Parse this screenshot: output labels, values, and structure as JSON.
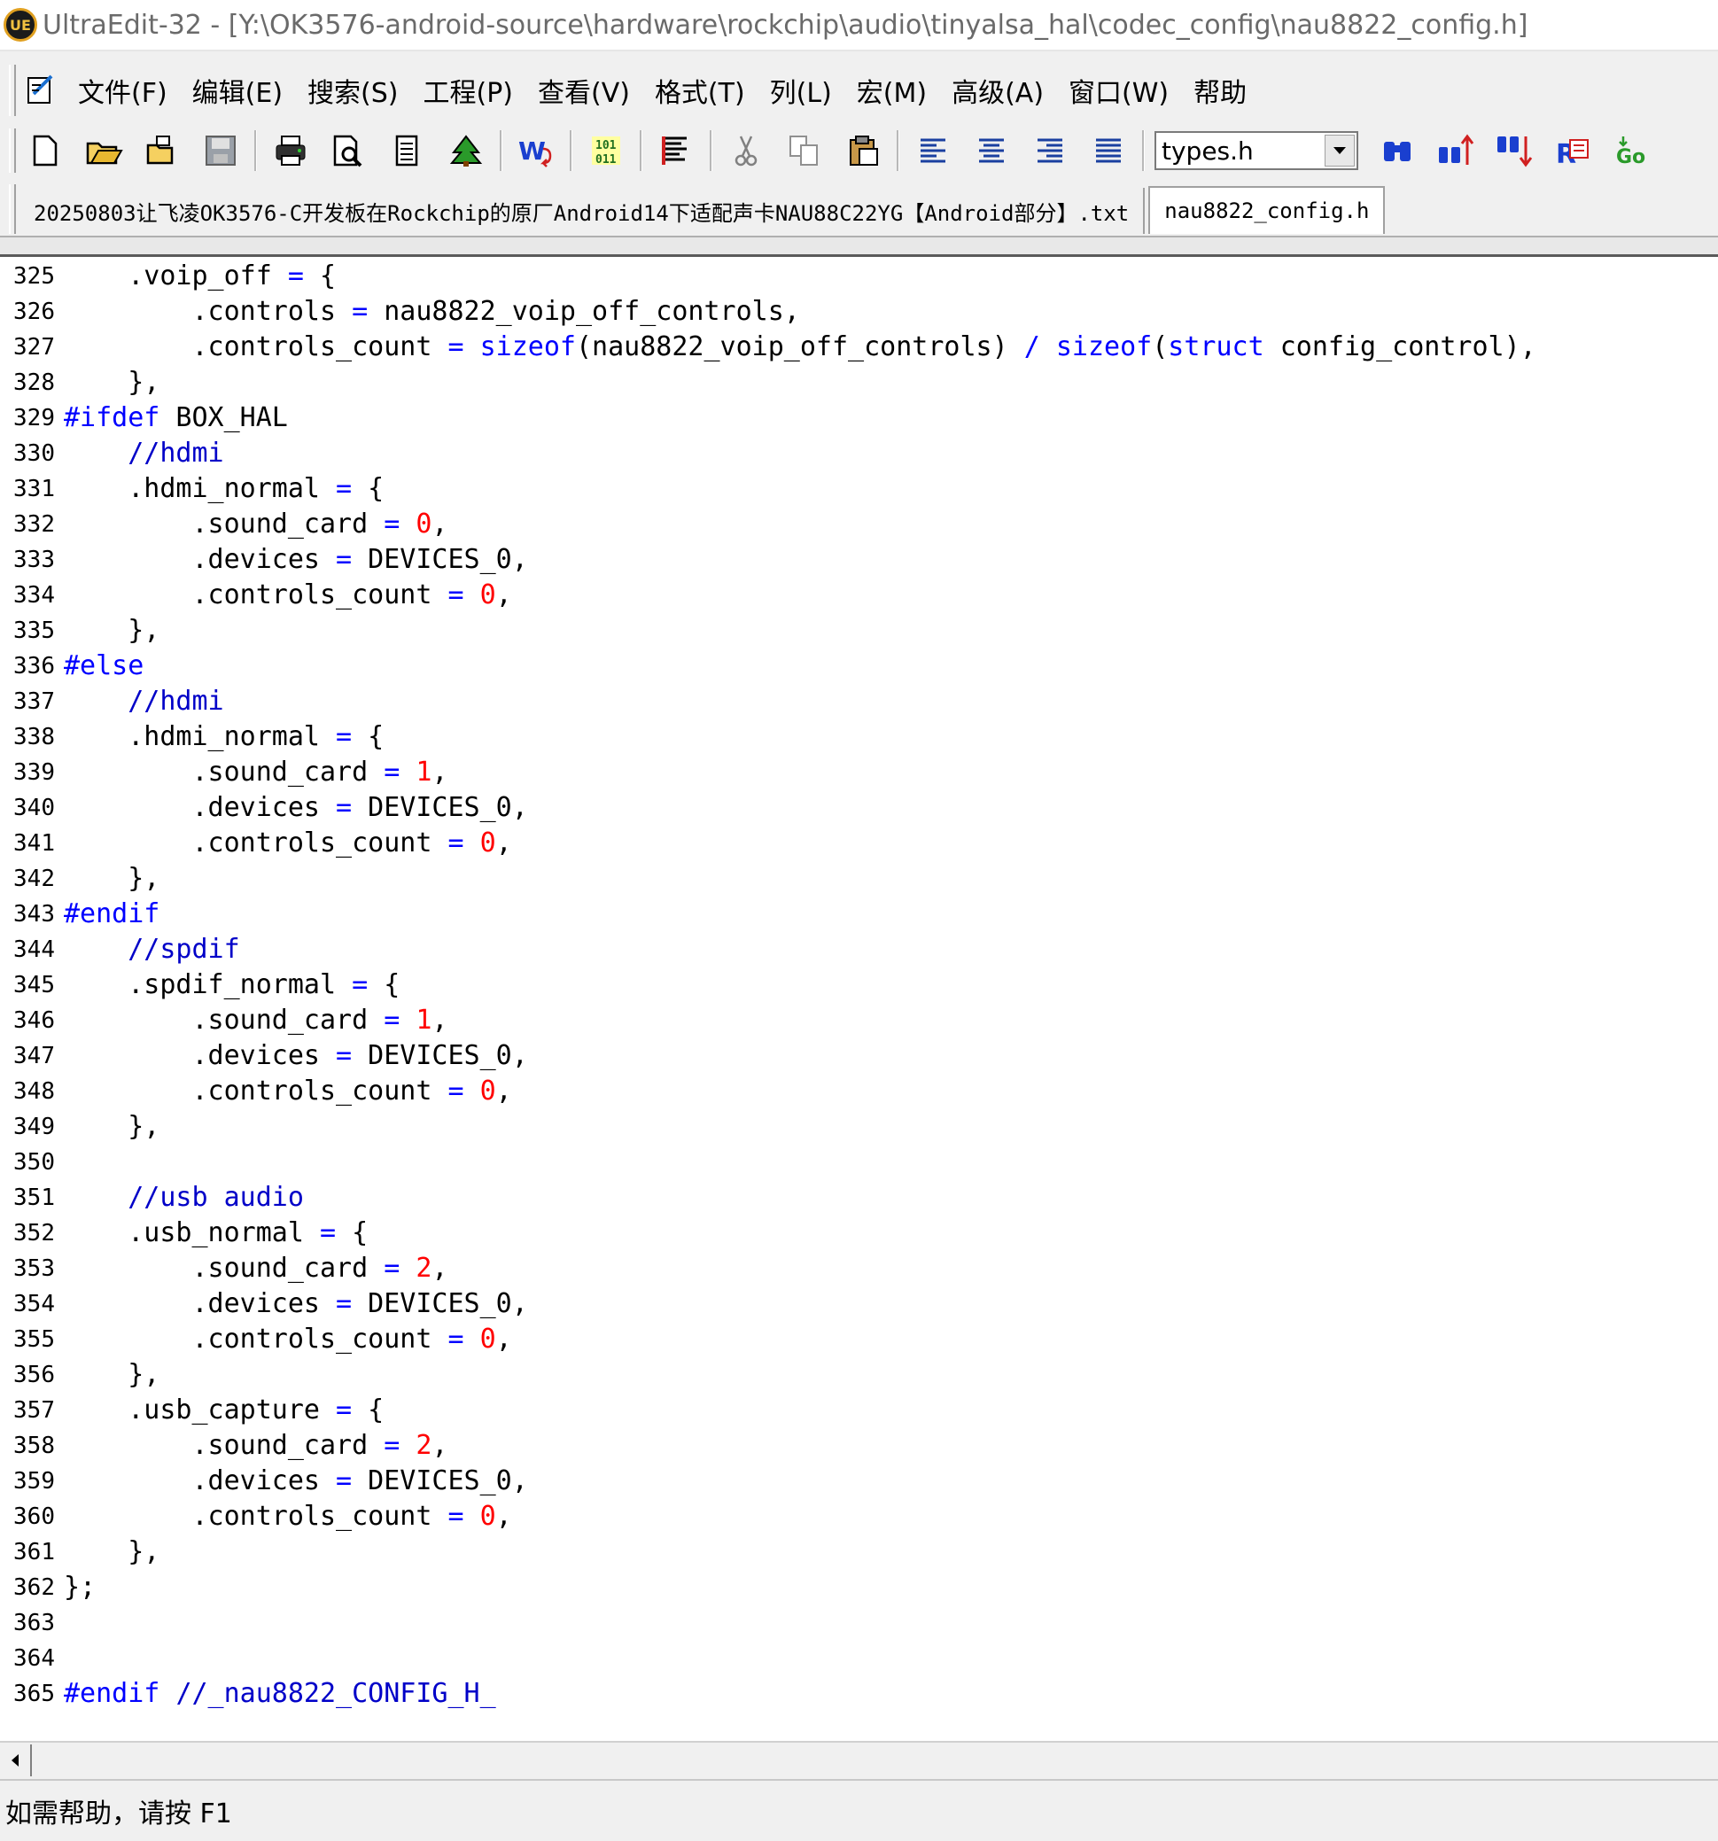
{
  "window": {
    "title": "UltraEdit-32 - [Y:\\OK3576-android-source\\hardware\\rockchip\\audio\\tinyalsa_hal\\codec_config\\nau8822_config.h]",
    "logo_text": "UE"
  },
  "menu": {
    "items": [
      "文件(F)",
      "编辑(E)",
      "搜索(S)",
      "工程(P)",
      "查看(V)",
      "格式(T)",
      "列(L)",
      "宏(M)",
      "高级(A)",
      "窗口(W)",
      "帮助"
    ]
  },
  "toolbar": {
    "buttons": [
      "new-file-icon",
      "open-file-icon",
      "open-recent-icon",
      "save-icon",
      "print-icon",
      "print-preview-icon",
      "column-markers-icon",
      "tree-icon",
      "word-wrap-icon",
      "hex-mode-icon",
      "spell-check-icon",
      "cut-icon",
      "copy-icon",
      "paste-icon",
      "align-left-icon",
      "align-center-icon",
      "align-right-icon",
      "justify-icon"
    ],
    "function_combo_value": "types.h",
    "search_buttons": [
      "find-icon",
      "find-previous-icon",
      "find-next-icon",
      "replace-icon",
      "goto-icon"
    ]
  },
  "tabs": [
    {
      "label": "20250803让飞凌OK3576-C开发板在Rockchip的原厂Android14下适配声卡NAU88C22YG【Android部分】.txt",
      "active": false
    },
    {
      "label": "nau8822_config.h",
      "active": true
    }
  ],
  "code": [
    {
      "n": "325",
      "tokens": [
        [
          "t",
          "    .voip_off "
        ],
        [
          "op",
          "="
        ],
        [
          "t",
          " {"
        ]
      ]
    },
    {
      "n": "326",
      "tokens": [
        [
          "t",
          "        .controls "
        ],
        [
          "op",
          "="
        ],
        [
          "t",
          " nau8822_voip_off_controls,"
        ]
      ]
    },
    {
      "n": "327",
      "tokens": [
        [
          "t",
          "        .controls_count "
        ],
        [
          "op",
          "="
        ],
        [
          "t",
          " "
        ],
        [
          "kw",
          "sizeof"
        ],
        [
          "t",
          "(nau8822_voip_off_controls) "
        ],
        [
          "op",
          "/"
        ],
        [
          "t",
          " "
        ],
        [
          "kw",
          "sizeof"
        ],
        [
          "t",
          "("
        ],
        [
          "kw",
          "struct"
        ],
        [
          "t",
          " config_control),"
        ]
      ]
    },
    {
      "n": "328",
      "tokens": [
        [
          "t",
          "    },"
        ]
      ]
    },
    {
      "n": "329",
      "tokens": [
        [
          "kw",
          "#ifdef"
        ],
        [
          "t",
          " BOX_HAL"
        ]
      ]
    },
    {
      "n": "330",
      "tokens": [
        [
          "t",
          "    "
        ],
        [
          "cm",
          "//hdmi"
        ]
      ]
    },
    {
      "n": "331",
      "tokens": [
        [
          "t",
          "    .hdmi_normal "
        ],
        [
          "op",
          "="
        ],
        [
          "t",
          " {"
        ]
      ]
    },
    {
      "n": "332",
      "tokens": [
        [
          "t",
          "        .sound_card "
        ],
        [
          "op",
          "="
        ],
        [
          "t",
          " "
        ],
        [
          "num",
          "0"
        ],
        [
          "t",
          ","
        ]
      ]
    },
    {
      "n": "333",
      "tokens": [
        [
          "t",
          "        .devices "
        ],
        [
          "op",
          "="
        ],
        [
          "t",
          " DEVICES_0,"
        ]
      ]
    },
    {
      "n": "334",
      "tokens": [
        [
          "t",
          "        .controls_count "
        ],
        [
          "op",
          "="
        ],
        [
          "t",
          " "
        ],
        [
          "num",
          "0"
        ],
        [
          "t",
          ","
        ]
      ]
    },
    {
      "n": "335",
      "tokens": [
        [
          "t",
          "    },"
        ]
      ]
    },
    {
      "n": "336",
      "tokens": [
        [
          "kw",
          "#else"
        ]
      ]
    },
    {
      "n": "337",
      "tokens": [
        [
          "t",
          "    "
        ],
        [
          "cm",
          "//hdmi"
        ]
      ]
    },
    {
      "n": "338",
      "tokens": [
        [
          "t",
          "    .hdmi_normal "
        ],
        [
          "op",
          "="
        ],
        [
          "t",
          " {"
        ]
      ]
    },
    {
      "n": "339",
      "tokens": [
        [
          "t",
          "        .sound_card "
        ],
        [
          "op",
          "="
        ],
        [
          "t",
          " "
        ],
        [
          "num",
          "1"
        ],
        [
          "t",
          ","
        ]
      ]
    },
    {
      "n": "340",
      "tokens": [
        [
          "t",
          "        .devices "
        ],
        [
          "op",
          "="
        ],
        [
          "t",
          " DEVICES_0,"
        ]
      ]
    },
    {
      "n": "341",
      "tokens": [
        [
          "t",
          "        .controls_count "
        ],
        [
          "op",
          "="
        ],
        [
          "t",
          " "
        ],
        [
          "num",
          "0"
        ],
        [
          "t",
          ","
        ]
      ]
    },
    {
      "n": "342",
      "tokens": [
        [
          "t",
          "    },"
        ]
      ]
    },
    {
      "n": "343",
      "tokens": [
        [
          "kw",
          "#endif"
        ]
      ]
    },
    {
      "n": "344",
      "tokens": [
        [
          "t",
          "    "
        ],
        [
          "cm",
          "//spdif"
        ]
      ]
    },
    {
      "n": "345",
      "tokens": [
        [
          "t",
          "    .spdif_normal "
        ],
        [
          "op",
          "="
        ],
        [
          "t",
          " {"
        ]
      ]
    },
    {
      "n": "346",
      "tokens": [
        [
          "t",
          "        .sound_card "
        ],
        [
          "op",
          "="
        ],
        [
          "t",
          " "
        ],
        [
          "num",
          "1"
        ],
        [
          "t",
          ","
        ]
      ]
    },
    {
      "n": "347",
      "tokens": [
        [
          "t",
          "        .devices "
        ],
        [
          "op",
          "="
        ],
        [
          "t",
          " DEVICES_0,"
        ]
      ]
    },
    {
      "n": "348",
      "tokens": [
        [
          "t",
          "        .controls_count "
        ],
        [
          "op",
          "="
        ],
        [
          "t",
          " "
        ],
        [
          "num",
          "0"
        ],
        [
          "t",
          ","
        ]
      ]
    },
    {
      "n": "349",
      "tokens": [
        [
          "t",
          "    },"
        ]
      ]
    },
    {
      "n": "350",
      "tokens": []
    },
    {
      "n": "351",
      "tokens": [
        [
          "t",
          "    "
        ],
        [
          "cm",
          "//usb audio"
        ]
      ]
    },
    {
      "n": "352",
      "tokens": [
        [
          "t",
          "    .usb_normal "
        ],
        [
          "op",
          "="
        ],
        [
          "t",
          " {"
        ]
      ]
    },
    {
      "n": "353",
      "tokens": [
        [
          "t",
          "        .sound_card "
        ],
        [
          "op",
          "="
        ],
        [
          "t",
          " "
        ],
        [
          "num",
          "2"
        ],
        [
          "t",
          ","
        ]
      ]
    },
    {
      "n": "354",
      "tokens": [
        [
          "t",
          "        .devices "
        ],
        [
          "op",
          "="
        ],
        [
          "t",
          " DEVICES_0,"
        ]
      ]
    },
    {
      "n": "355",
      "tokens": [
        [
          "t",
          "        .controls_count "
        ],
        [
          "op",
          "="
        ],
        [
          "t",
          " "
        ],
        [
          "num",
          "0"
        ],
        [
          "t",
          ","
        ]
      ]
    },
    {
      "n": "356",
      "tokens": [
        [
          "t",
          "    },"
        ]
      ]
    },
    {
      "n": "357",
      "tokens": [
        [
          "t",
          "    .usb_capture "
        ],
        [
          "op",
          "="
        ],
        [
          "t",
          " {"
        ]
      ]
    },
    {
      "n": "358",
      "tokens": [
        [
          "t",
          "        .sound_card "
        ],
        [
          "op",
          "="
        ],
        [
          "t",
          " "
        ],
        [
          "num",
          "2"
        ],
        [
          "t",
          ","
        ]
      ]
    },
    {
      "n": "359",
      "tokens": [
        [
          "t",
          "        .devices "
        ],
        [
          "op",
          "="
        ],
        [
          "t",
          " DEVICES_0,"
        ]
      ]
    },
    {
      "n": "360",
      "tokens": [
        [
          "t",
          "        .controls_count "
        ],
        [
          "op",
          "="
        ],
        [
          "t",
          " "
        ],
        [
          "num",
          "0"
        ],
        [
          "t",
          ","
        ]
      ]
    },
    {
      "n": "361",
      "tokens": [
        [
          "t",
          "    },"
        ]
      ]
    },
    {
      "n": "362",
      "tokens": [
        [
          "t",
          "};"
        ]
      ]
    },
    {
      "n": "363",
      "tokens": []
    },
    {
      "n": "364",
      "tokens": []
    },
    {
      "n": "365",
      "tokens": [
        [
          "kw",
          "#endif"
        ],
        [
          "t",
          " "
        ],
        [
          "cm",
          "//_nau8822_CONFIG_H_"
        ]
      ]
    }
  ],
  "status": {
    "help_text": "如需帮助，请按 F1"
  },
  "colors": {
    "keyword": "#0000ff",
    "comment": "#0000c8",
    "number": "#ff0000",
    "text": "#000000"
  }
}
